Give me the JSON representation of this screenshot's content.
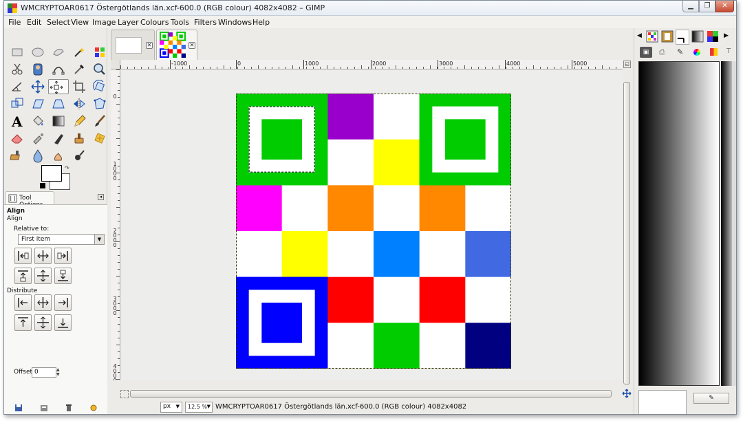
{
  "window": {
    "title": "WMCRYPTOAR0617 Östergötlands län.xcf-600.0 (RGB colour) 4082x4082 – GIMP"
  },
  "menubar": {
    "items": [
      "File",
      "Edit",
      "Select",
      "View",
      "Image",
      "Layer",
      "Colours",
      "Tools",
      "Filters",
      "Windows",
      "Help"
    ]
  },
  "toolbox": {
    "tools": [
      "rect-select-icon",
      "ellipse-select-icon",
      "free-select-icon",
      "fuzzy-select-icon",
      "select-by-color-icon",
      "scissors-icon",
      "foreground-select-icon",
      "paths-icon",
      "color-picker-icon",
      "zoom-icon",
      "measure-icon",
      "move-icon",
      "align-icon",
      "crop-icon",
      "rotate-icon",
      "scale-icon",
      "shear-icon",
      "perspective-icon",
      "flip-icon",
      "cage-icon",
      "text-icon",
      "bucket-fill-icon",
      "blend-icon",
      "pencil-icon",
      "paintbrush-icon",
      "eraser-icon",
      "airbrush-icon",
      "ink-icon",
      "clone-icon",
      "heal-icon",
      "perspective-clone-icon",
      "blur-icon",
      "smudge-icon",
      "dodge-burn-icon"
    ],
    "active_tool": "align-icon",
    "colors": {
      "foreground": "#000000",
      "background": "#ffffff"
    }
  },
  "tool_options": {
    "tab_label": "Tool Options",
    "title": "Align",
    "subtitle": "Align",
    "relative_label": "Relative to:",
    "relative_value": "First item",
    "distribute_label": "Distribute",
    "offset_label": "Offset:",
    "offset_value": "0"
  },
  "rulers": {
    "horizontal": [
      "-1000",
      "0",
      "1000",
      "2000",
      "3000",
      "4000",
      "5000"
    ],
    "vertical": [
      "0",
      "1000",
      "2000",
      "3000",
      "4000"
    ]
  },
  "image": {
    "grid": [
      [
        "#00cc00",
        "#00cc00",
        "#9900cc",
        "#ffffff",
        "#00cc00",
        "#00cc00"
      ],
      [
        "#00cc00",
        "#00cc00",
        "#ffffff",
        "#ffff00",
        "#00cc00",
        "#00cc00"
      ],
      [
        "#ff00ff",
        "#ffffff",
        "#ff8800",
        "#ffffff",
        "#ff8800",
        "#ffffff"
      ],
      [
        "#ffffff",
        "#ffff00",
        "#ffffff",
        "#0080ff",
        "#ffffff",
        "#4169e1"
      ],
      [
        "#0000ff",
        "#0000ff",
        "#ff0000",
        "#ffffff",
        "#ff0000",
        "#ffffff"
      ],
      [
        "#0000ff",
        "#0000ff",
        "#ffffff",
        "#00cc00",
        "#ffffff",
        "#000080"
      ]
    ],
    "finder_colors": {
      "top_left": "#00cc00",
      "top_right": "#00cc00",
      "bottom_left": "#0000ff"
    }
  },
  "statusbar": {
    "unit": "px",
    "zoom": "12.5 %",
    "text": "WMCRYPTOAR0617 Östergötlands län.xcf-600.0 (RGB colour) 4082x4082"
  }
}
